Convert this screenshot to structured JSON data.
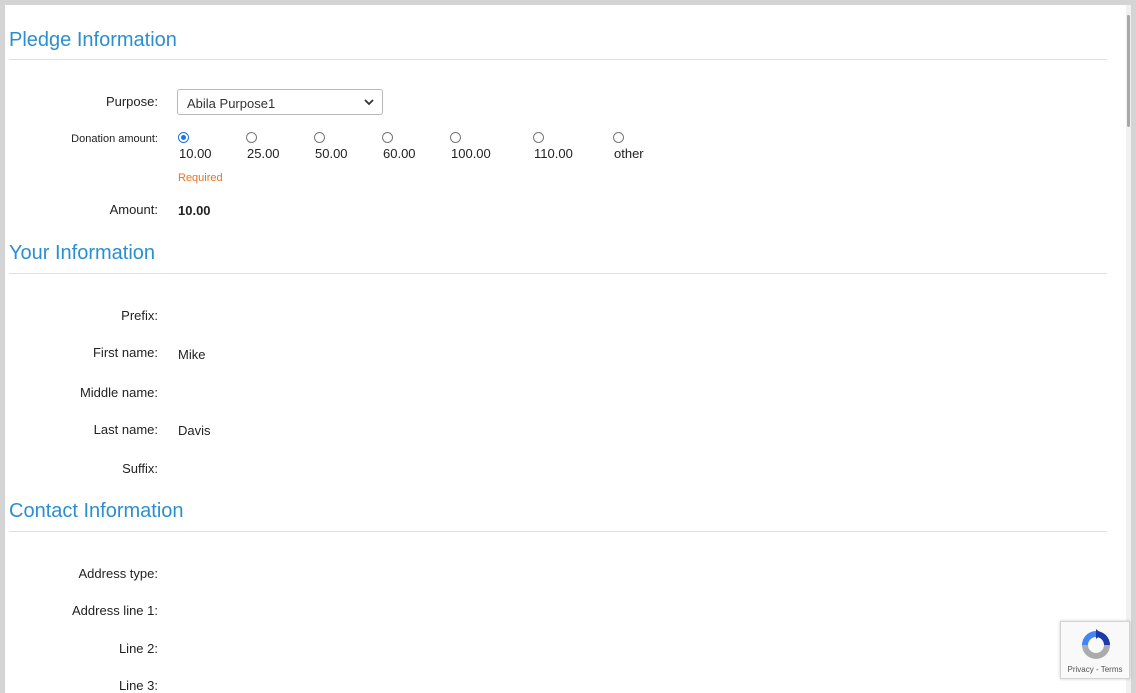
{
  "pledge": {
    "title": "Pledge Information",
    "purpose_label": "Purpose:",
    "purpose_value": "Abila Purpose1",
    "donation_label": "Donation amount:",
    "donation_options": [
      "10.00",
      "25.00",
      "50.00",
      "60.00",
      "100.00",
      "110.00",
      "other"
    ],
    "selected_option": "10.00",
    "required_text": "Required",
    "amount_label": "Amount:",
    "amount_value": "10.00"
  },
  "your_info": {
    "title": "Your Information",
    "prefix_label": "Prefix:",
    "prefix_value": "",
    "first_name_label": "First name:",
    "first_name_value": "Mike",
    "middle_name_label": "Middle name:",
    "middle_name_value": "",
    "last_name_label": "Last name:",
    "last_name_value": "Davis",
    "suffix_label": "Suffix:",
    "suffix_value": ""
  },
  "contact": {
    "title": "Contact Information",
    "address_type_label": "Address type:",
    "address_line1_label": "Address line 1:",
    "line2_label": "Line 2:",
    "line3_label": "Line 3:"
  },
  "recaptcha": {
    "privacy": "Privacy",
    "separator": " - ",
    "terms": "Terms",
    "colors": {
      "blue": "#1c3aa9",
      "light_blue": "#4285f4",
      "gray": "#ababab"
    }
  },
  "colors": {
    "heading": "#2b8fcf",
    "required": "#e8731f",
    "radio_checked": "#1a73e8"
  }
}
